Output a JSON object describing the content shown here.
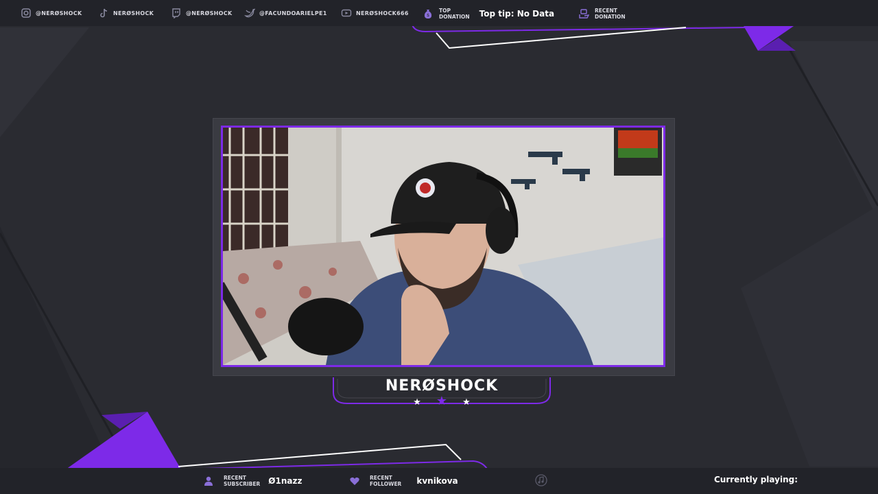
{
  "colors": {
    "accent": "#7d2ae8",
    "background": "#2a2b31",
    "bar": "#222329"
  },
  "socials": [
    {
      "icon": "instagram-icon",
      "handle": "@NERØSHOCK"
    },
    {
      "icon": "tiktok-icon",
      "handle": "NERØSHOCK"
    },
    {
      "icon": "twitch-icon",
      "handle": "@NERØSHOCK"
    },
    {
      "icon": "twitter-icon",
      "handle": "@FACUNDOARIELPE1"
    },
    {
      "icon": "youtube-icon",
      "handle": "NERØSHOCK666"
    }
  ],
  "top_donation": {
    "icon": "money-bag-icon",
    "label_line1": "TOP",
    "label_line2": "DONATION",
    "value": "Top tip: No Data"
  },
  "recent_donation": {
    "icon": "money-hand-icon",
    "label_line1": "RECENT",
    "label_line2": "DONATION",
    "value": ""
  },
  "streamer": {
    "name": "NERØSHOCK"
  },
  "recent_subscriber": {
    "icon": "user-icon",
    "label_line1": "RECENT",
    "label_line2": "SUBSCRIBER",
    "value": "Ø1nazz"
  },
  "recent_follower": {
    "icon": "heart-icon",
    "label_line1": "RECENT",
    "label_line2": "FOLLOWER",
    "value": "kvnikova"
  },
  "music": {
    "icon": "music-note-icon",
    "label": "Currently playing:",
    "value": ""
  }
}
